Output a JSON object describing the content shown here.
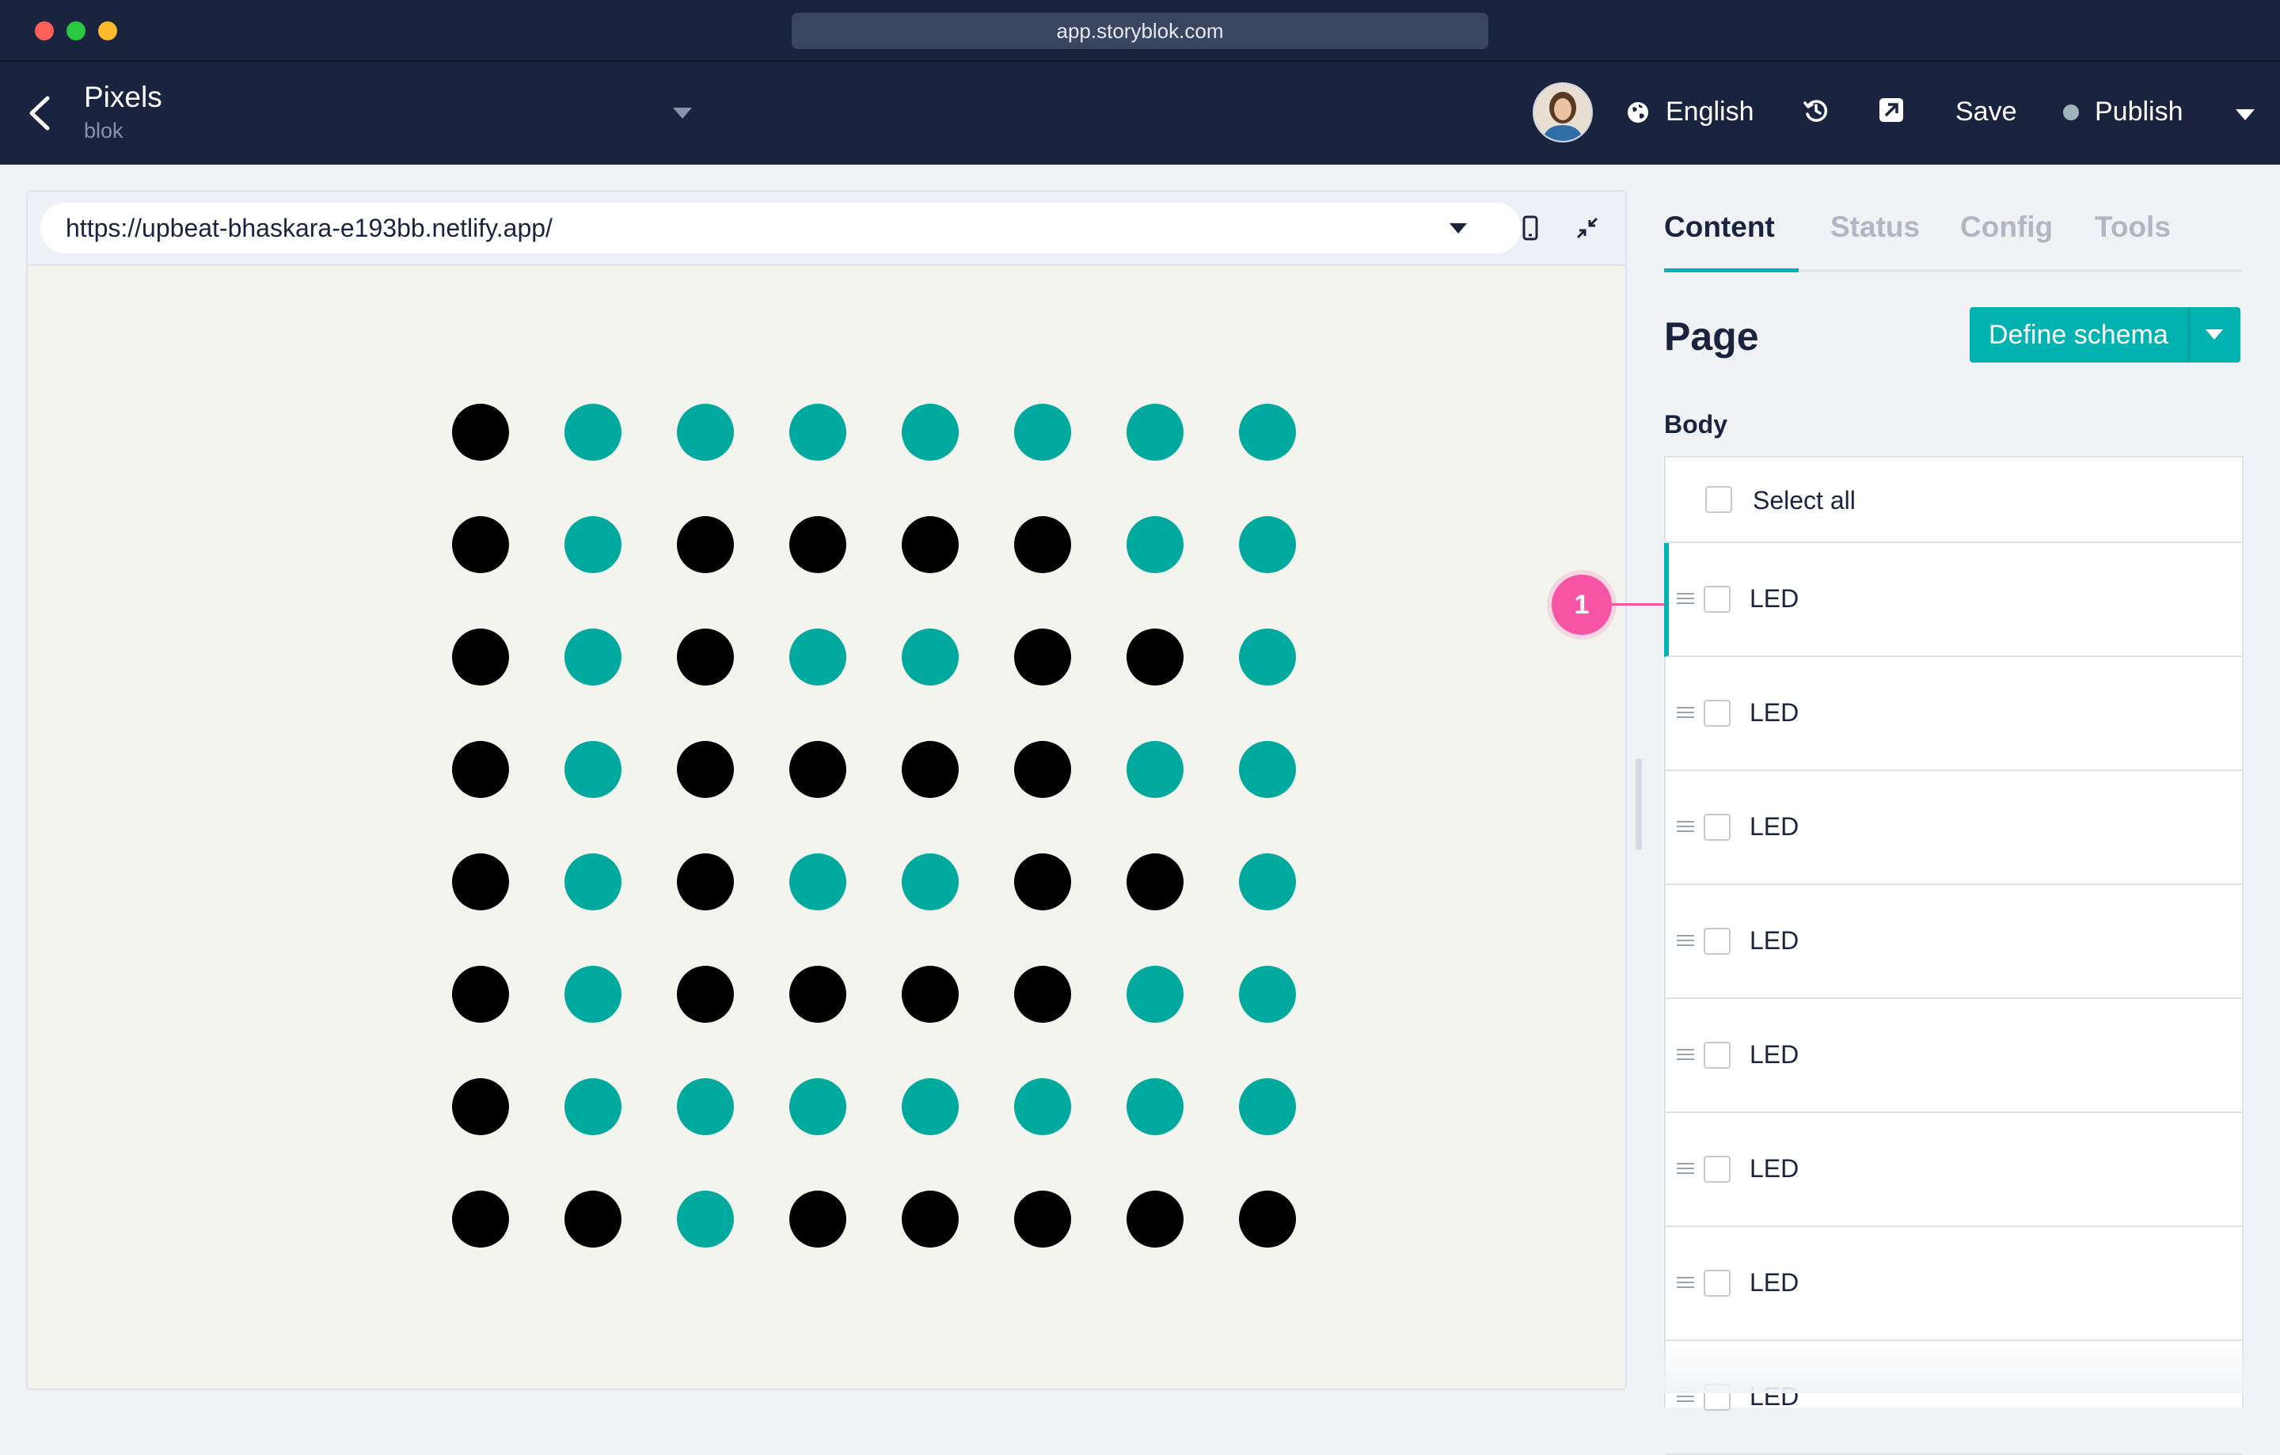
{
  "window": {
    "url_display": "app.storyblok.com"
  },
  "header": {
    "title": "Pixels",
    "subtitle": "blok",
    "language": "English",
    "save_label": "Save",
    "publish_label": "Publish"
  },
  "preview": {
    "url": "https://upbeat-bhaskara-e193bb.netlify.app/",
    "grid": [
      [
        0,
        1,
        1,
        1,
        1,
        1,
        1,
        1
      ],
      [
        0,
        1,
        0,
        0,
        0,
        0,
        1,
        1
      ],
      [
        0,
        1,
        0,
        1,
        1,
        0,
        0,
        1
      ],
      [
        0,
        1,
        0,
        0,
        0,
        0,
        1,
        1
      ],
      [
        0,
        1,
        0,
        1,
        1,
        0,
        0,
        1
      ],
      [
        0,
        1,
        0,
        0,
        0,
        0,
        1,
        1
      ],
      [
        0,
        1,
        1,
        1,
        1,
        1,
        1,
        1
      ],
      [
        0,
        0,
        1,
        0,
        0,
        0,
        0,
        0
      ]
    ],
    "colors": {
      "on": "#00a99d",
      "off": "#000000"
    }
  },
  "sidebar": {
    "tabs": [
      {
        "label": "Content",
        "active": true
      },
      {
        "label": "Status"
      },
      {
        "label": "Config"
      },
      {
        "label": "Tools"
      }
    ],
    "page_title": "Page",
    "define_schema_label": "Define schema",
    "body_label": "Body",
    "select_all_label": "Select all",
    "items": [
      {
        "label": "LED"
      },
      {
        "label": "LED"
      },
      {
        "label": "LED"
      },
      {
        "label": "LED"
      },
      {
        "label": "LED"
      },
      {
        "label": "LED"
      },
      {
        "label": "LED"
      },
      {
        "label": "LED"
      }
    ]
  },
  "annotation": {
    "number": "1"
  },
  "colors": {
    "navy": "#1b243f",
    "accent": "#00b3b0",
    "annotation": "#f754a6"
  }
}
